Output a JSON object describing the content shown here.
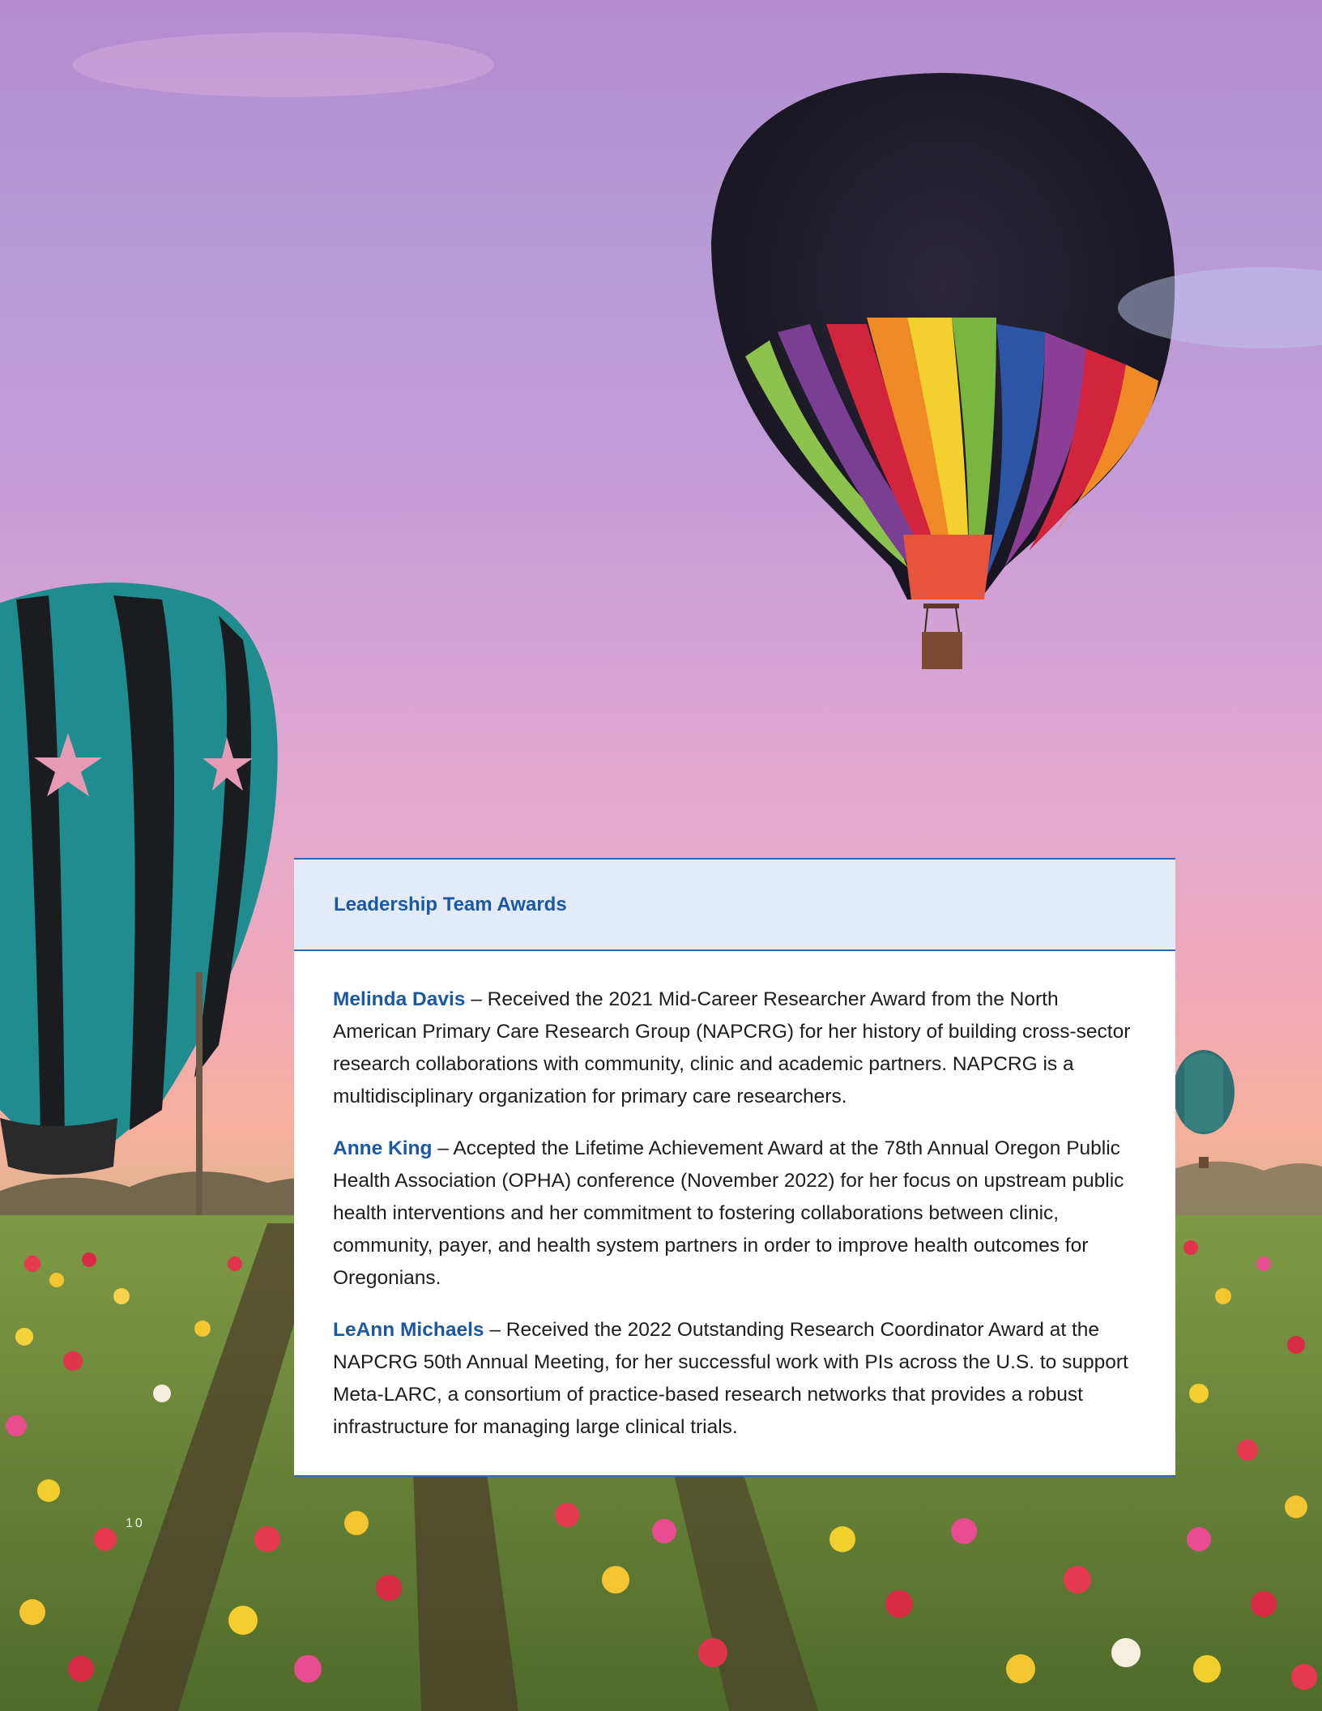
{
  "section": {
    "title": "Leadership Team Awards"
  },
  "awards": [
    {
      "name": "Melinda Davis",
      "text": " – Received the 2021 Mid-Career Researcher Award from the North American Primary Care Research Group (NAPCRG) for her history of building cross-sector research collaborations with community, clinic and academic partners. NAPCRG is a multidisciplinary organization for primary care researchers."
    },
    {
      "name": "Anne King",
      "text": " – Accepted the Lifetime Achievement Award at the 78th Annual Oregon Public Health Association (OPHA) conference (November 2022) for her focus on upstream public health interventions and her commitment to fostering collaborations between clinic, community, payer, and health system partners in order to improve health outcomes for Oregonians."
    },
    {
      "name": "LeAnn Michaels",
      "text": " – Received the 2022 Outstanding Research Coordinator Award at the NAPCRG 50th Annual Meeting, for her successful work with PIs across the U.S. to support Meta-LARC, a consortium of practice-based research networks that provides a robust infrastructure for managing large clinical trials."
    }
  ],
  "page_number": "10",
  "colors": {
    "accent": "#1b58a0",
    "header_bg": "#e3ebf6",
    "rule": "#2f69b3"
  }
}
